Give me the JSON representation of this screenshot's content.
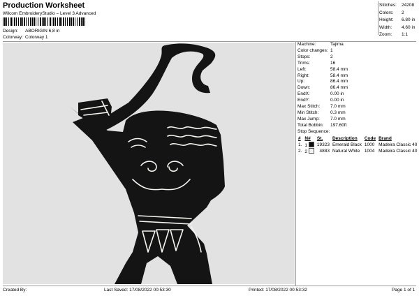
{
  "header": {
    "title": "Production Worksheet",
    "subtitle": "Wilcom EmbroideryStudio – Level 3 Advanced",
    "design_label": "Design:",
    "design_value": "ABORIGIN 6,8 in",
    "colorway_label": "Colorway:",
    "colorway_value": "Colorway 1"
  },
  "stats": [
    {
      "label": "Stitches:",
      "value": "24208"
    },
    {
      "label": "Colors:",
      "value": "2"
    },
    {
      "label": "Height:",
      "value": "6.80 in"
    },
    {
      "label": "Width:",
      "value": "4.60 in"
    },
    {
      "label": "Zoom:",
      "value": "1:1"
    }
  ],
  "properties": [
    {
      "label": "Machine:",
      "value": "Tajima"
    },
    {
      "label": "Color changes:",
      "value": "1"
    },
    {
      "label": "Stops:",
      "value": "2"
    },
    {
      "label": "Trims:",
      "value": "16"
    },
    {
      "label": "Left:",
      "value": "58.4 mm"
    },
    {
      "label": "Right:",
      "value": "58.4 mm"
    },
    {
      "label": "Up:",
      "value": "86.4 mm"
    },
    {
      "label": "Down:",
      "value": "86.4 mm"
    },
    {
      "label": "EndX:",
      "value": "0.00 in"
    },
    {
      "label": "EndY:",
      "value": "0.00 in"
    },
    {
      "label": "Max Stitch:",
      "value": "7.0 mm"
    },
    {
      "label": "Min Stitch:",
      "value": "0.3 mm"
    },
    {
      "label": "Max Jump:",
      "value": "7.0 mm"
    },
    {
      "label": "Total Bobbin:",
      "value": "197.60ft"
    }
  ],
  "stop_sequence": {
    "label": "Stop Sequence:",
    "headers": {
      "num": "#",
      "n": "N#",
      "st": "St.",
      "description": "Description",
      "code": "Code",
      "brand": "Brand"
    },
    "rows": [
      {
        "num": "1.",
        "n": "1",
        "color": "#111111",
        "st": "19323",
        "description": "Emerald Black",
        "code": "1000",
        "brand": "Madeira Classic 40"
      },
      {
        "num": "2.",
        "n": "2",
        "color": "#f4f4f0",
        "st": "4883",
        "description": "Natural White",
        "code": "1004",
        "brand": "Madeira Classic 40"
      }
    ]
  },
  "footer": {
    "created": "Created By:",
    "saved": "Last Saved: 17/08/2022 00:53:30",
    "printed": "Printed: 17/08/2022 00:53:32",
    "page": "Page 1 of 1"
  },
  "colors": {
    "canvas_bg": "#e2e2e2",
    "fill": "#141414",
    "stitch_white": "#f4f4f0"
  }
}
